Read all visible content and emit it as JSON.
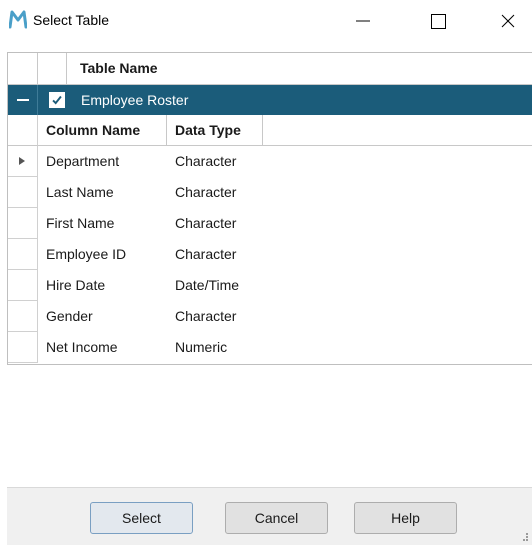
{
  "window": {
    "title": "Select Table",
    "icon": "m-logo-icon",
    "accent": "#1b5c7a"
  },
  "table_grid": {
    "header": {
      "column_label": "Table Name"
    },
    "master_row": {
      "label": "Employee Roster",
      "checked": true
    },
    "detail": {
      "columns": [
        "Column Name",
        "Data Type"
      ],
      "rows": [
        {
          "name": "Department",
          "type": "Character",
          "current": true
        },
        {
          "name": "Last Name",
          "type": "Character"
        },
        {
          "name": "First Name",
          "type": "Character"
        },
        {
          "name": "Employee ID",
          "type": "Character"
        },
        {
          "name": "Hire Date",
          "type": "Date/Time"
        },
        {
          "name": "Gender",
          "type": "Character"
        },
        {
          "name": "Net Income",
          "type": "Numeric"
        }
      ]
    }
  },
  "footer": {
    "select_label": "Select",
    "cancel_label": "Cancel",
    "help_label": "Help"
  }
}
